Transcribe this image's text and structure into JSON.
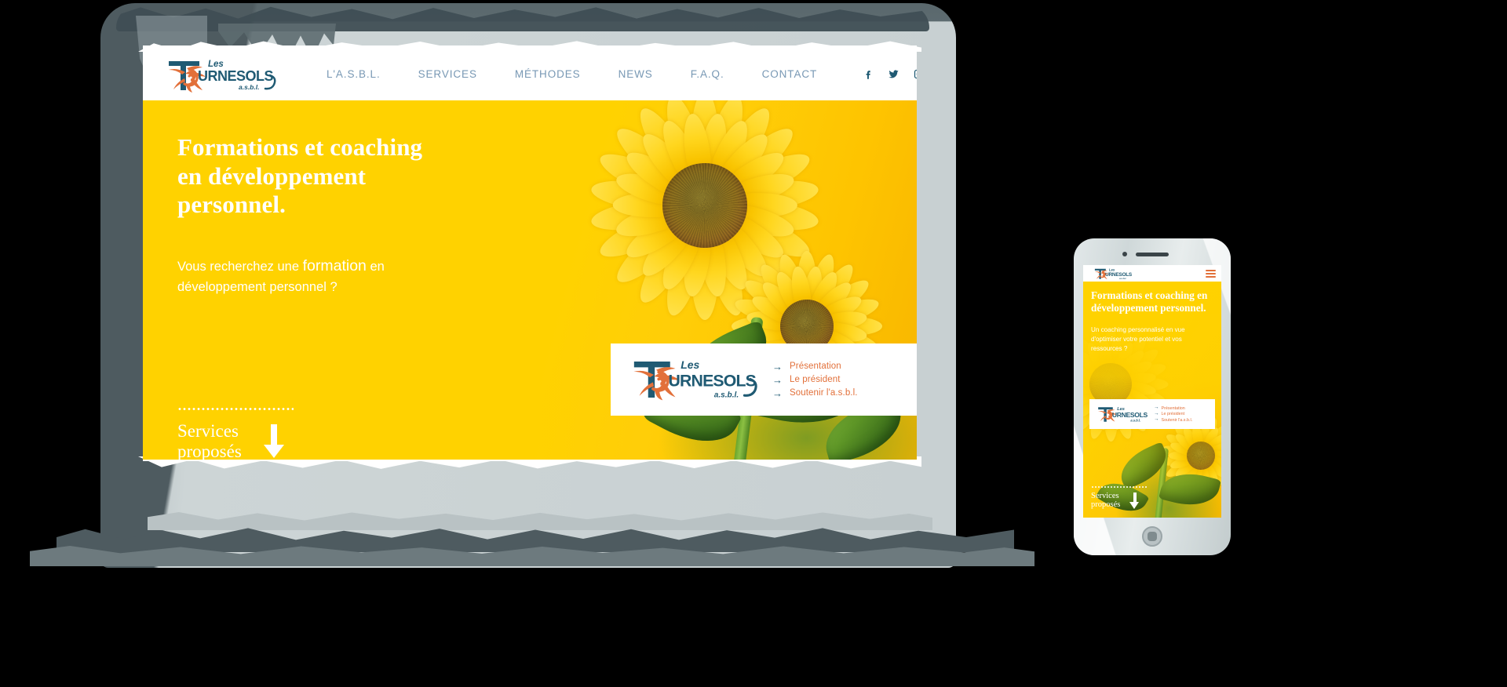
{
  "brand": {
    "name": "Les Tournesols a.s.b.l.",
    "logo_line1": "Les",
    "logo_line2": "TOURNESOLS",
    "logo_line3": "a.s.b.l.",
    "teal": "#1f5a73",
    "orange": "#E2703A",
    "yellow": "#FFD200"
  },
  "nav": {
    "items": [
      {
        "label": "L'A.S.B.L."
      },
      {
        "label": "SERVICES"
      },
      {
        "label": "MÉTHODES"
      },
      {
        "label": "NEWS"
      },
      {
        "label": "F.A.Q."
      },
      {
        "label": "CONTACT"
      }
    ],
    "social": [
      {
        "name": "facebook-icon",
        "glyph": "f"
      },
      {
        "name": "twitter-icon",
        "glyph": "t"
      },
      {
        "name": "instagram-icon",
        "glyph": "i"
      }
    ]
  },
  "hero": {
    "heading": "Formations et coaching en développement personnel.",
    "sub_lead": "Vous recherchez une ",
    "sub_em": "formation",
    "sub_rest": " en développement personnel ?",
    "cta_line1": "Services",
    "cta_line2": "proposés",
    "arrow": "down-arrow-icon"
  },
  "info_card": {
    "links": [
      {
        "label": "Présentation"
      },
      {
        "label": "Le président"
      },
      {
        "label": "Soutenir l'a.s.b.l."
      }
    ],
    "arrow_glyph": "→"
  },
  "mobile": {
    "heading": "Formations et coaching en développement personnel.",
    "sub": "Un coaching personnalisé en vue d'optimiser votre potentiel et vos ressources ?",
    "cta_line1": "Services",
    "cta_line2": "proposés",
    "menu_icon": "hamburger-menu-icon",
    "card_links": [
      {
        "label": "Présentation"
      },
      {
        "label": "Le président"
      },
      {
        "label": "Soutenir l'a.s.b.l."
      }
    ],
    "arrow_glyph": "→"
  }
}
